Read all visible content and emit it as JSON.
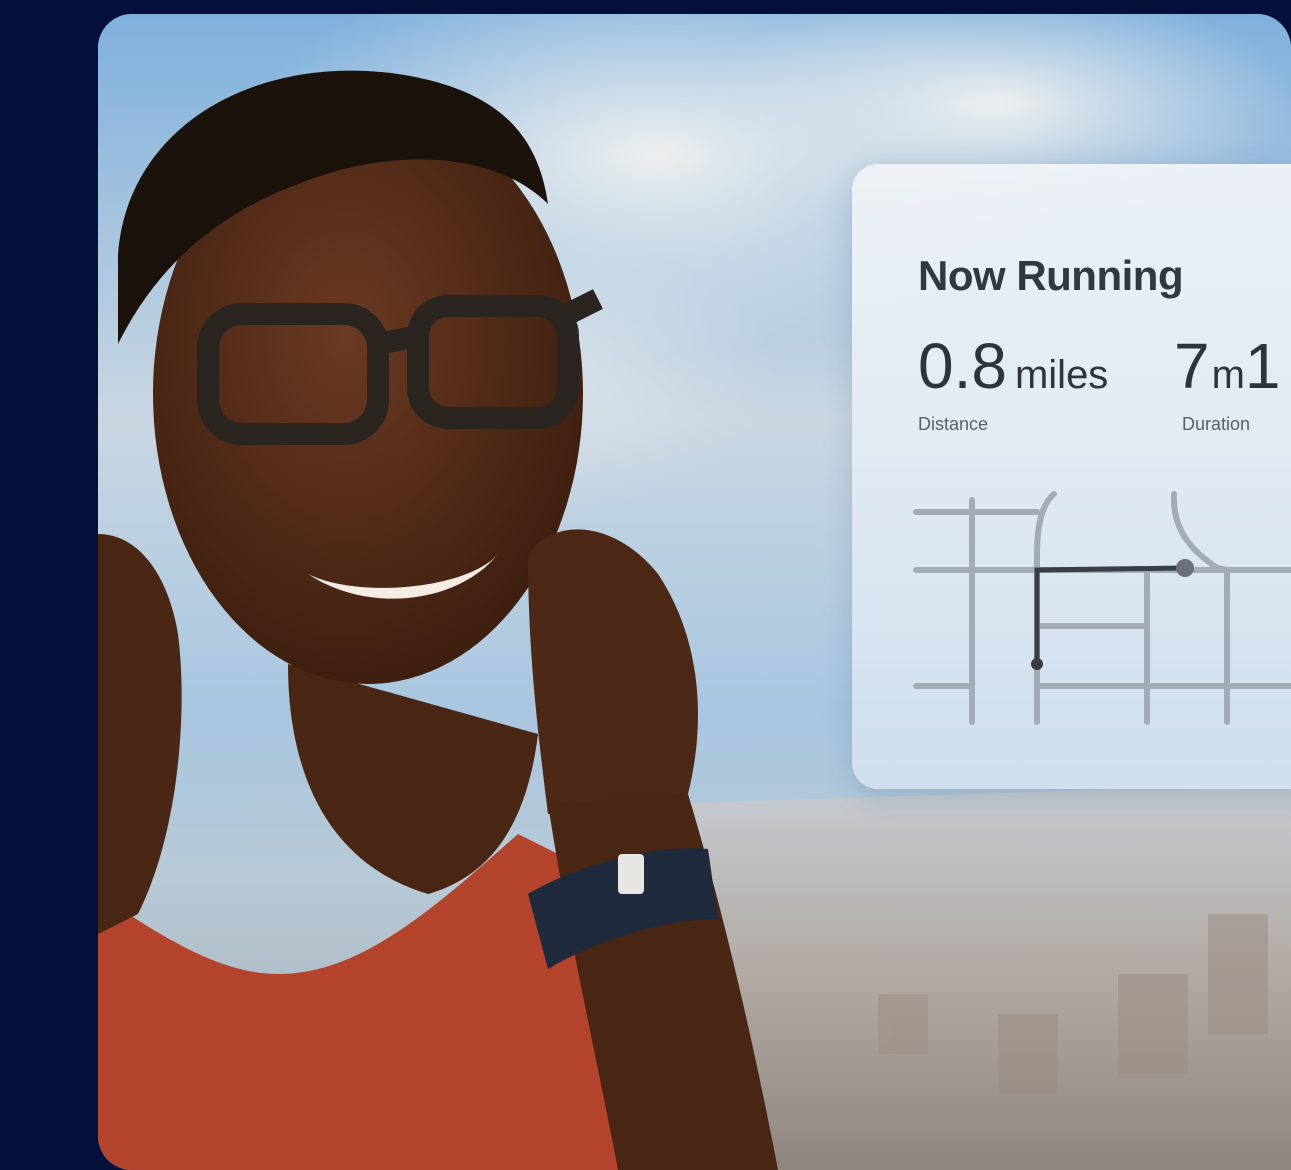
{
  "card": {
    "title": "Now Running",
    "distance": {
      "value": "0.8",
      "unit": "miles",
      "label": "Distance"
    },
    "duration": {
      "value": "7",
      "unit": "m",
      "trailing": "1",
      "label": "Duration"
    }
  },
  "colors": {
    "page_background": "#04103a",
    "card_text": "#33383f",
    "route_line": "#3a3e44",
    "street_lines": "#9aa4ae"
  },
  "icons": [
    "route-map-icon"
  ]
}
